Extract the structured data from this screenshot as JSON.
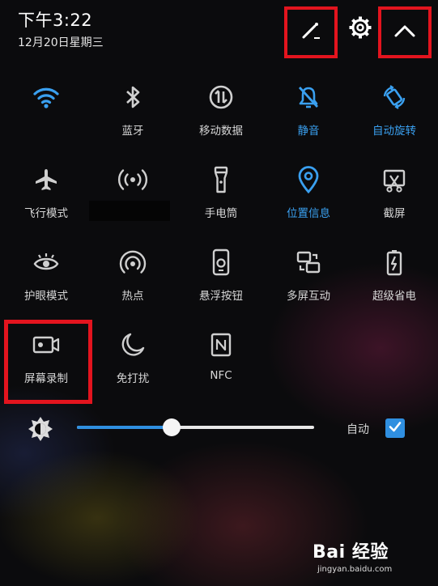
{
  "status": {
    "time": "下午3:22",
    "date": "12月20日星期三"
  },
  "toggles": [
    {
      "key": "wifi",
      "icon": "wifi-icon",
      "label": "",
      "active": true
    },
    {
      "key": "bluetooth",
      "icon": "bluetooth-icon",
      "label": "蓝牙",
      "active": false
    },
    {
      "key": "mobile-data",
      "icon": "mobile-data-icon",
      "label": "移动数据",
      "active": false
    },
    {
      "key": "mute",
      "icon": "mute-icon",
      "label": "静音",
      "active": true
    },
    {
      "key": "auto-rotate",
      "icon": "auto-rotate-icon",
      "label": "自动旋转",
      "active": true
    },
    {
      "key": "airplane-mode",
      "icon": "airplane-icon",
      "label": "飞行模式",
      "active": false
    },
    {
      "key": "hotspot-signal",
      "icon": "signal-icon",
      "label": "",
      "active": false
    },
    {
      "key": "flashlight",
      "icon": "flashlight-icon",
      "label": "手电筒",
      "active": false
    },
    {
      "key": "location",
      "icon": "location-icon",
      "label": "位置信息",
      "active": true
    },
    {
      "key": "screenshot",
      "icon": "screenshot-icon",
      "label": "截屏",
      "active": false
    },
    {
      "key": "eye-comfort",
      "icon": "eye-icon",
      "label": "护眼模式",
      "active": false
    },
    {
      "key": "hotspot",
      "icon": "hotspot-icon",
      "label": "热点",
      "active": false
    },
    {
      "key": "floating-button",
      "icon": "floating-button-icon",
      "label": "悬浮按钮",
      "active": false
    },
    {
      "key": "multi-screen",
      "icon": "multi-screen-icon",
      "label": "多屏互动",
      "active": false
    },
    {
      "key": "power-saver",
      "icon": "battery-icon",
      "label": "超级省电",
      "active": false
    },
    {
      "key": "screen-record",
      "icon": "screen-record-icon",
      "label": "屏幕录制",
      "active": false
    },
    {
      "key": "do-not-disturb",
      "icon": "moon-icon",
      "label": "免打扰",
      "active": false
    },
    {
      "key": "nfc",
      "icon": "nfc-icon",
      "label": "NFC",
      "active": false
    }
  ],
  "brightness": {
    "level_fraction": 0.4,
    "auto_label": "自动",
    "auto_checked": true
  },
  "colors": {
    "accent": "#2f8fe0",
    "highlight": "#e3141e",
    "text": "#d6d6d6"
  },
  "watermark": {
    "logo": "Bai 经验",
    "url": "jingyan.baidu.com"
  }
}
